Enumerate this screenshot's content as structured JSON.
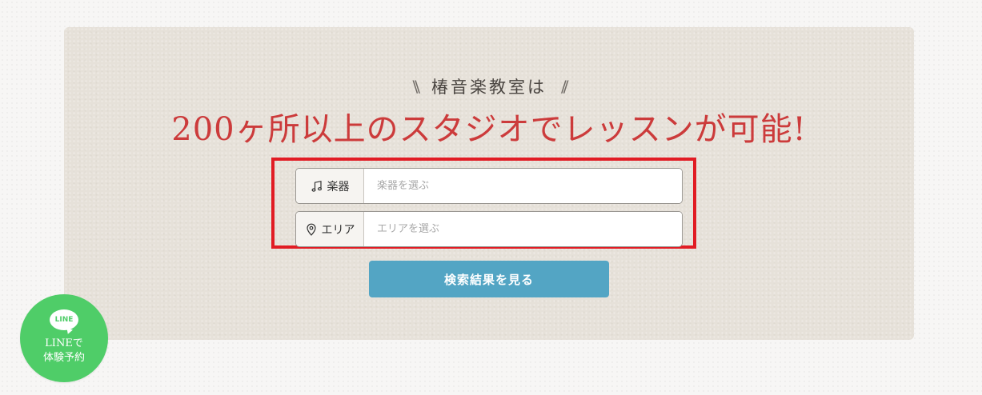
{
  "hero": {
    "subtitle": "椿音楽教室は",
    "subtitle_left_deco": "\\\\",
    "subtitle_right_deco": "//",
    "headline": "200ヶ所以上のスタジオでレッスンが可能!"
  },
  "search": {
    "instrument": {
      "label": "楽器",
      "icon": "music-note-icon",
      "placeholder": "楽器を選ぶ",
      "value": ""
    },
    "area": {
      "label": "エリア",
      "icon": "map-pin-icon",
      "placeholder": "エリアを選ぶ",
      "value": ""
    },
    "submit_label": "検索結果を見る"
  },
  "line_badge": {
    "logo_text": "LINE",
    "line1": "LINEで",
    "line2": "体験予約"
  },
  "colors": {
    "headline": "#cc3b3b",
    "button": "#53a5c4",
    "highlight": "#e11c24",
    "line_green": "#4fcd68",
    "panel": "#e6e1d9"
  }
}
